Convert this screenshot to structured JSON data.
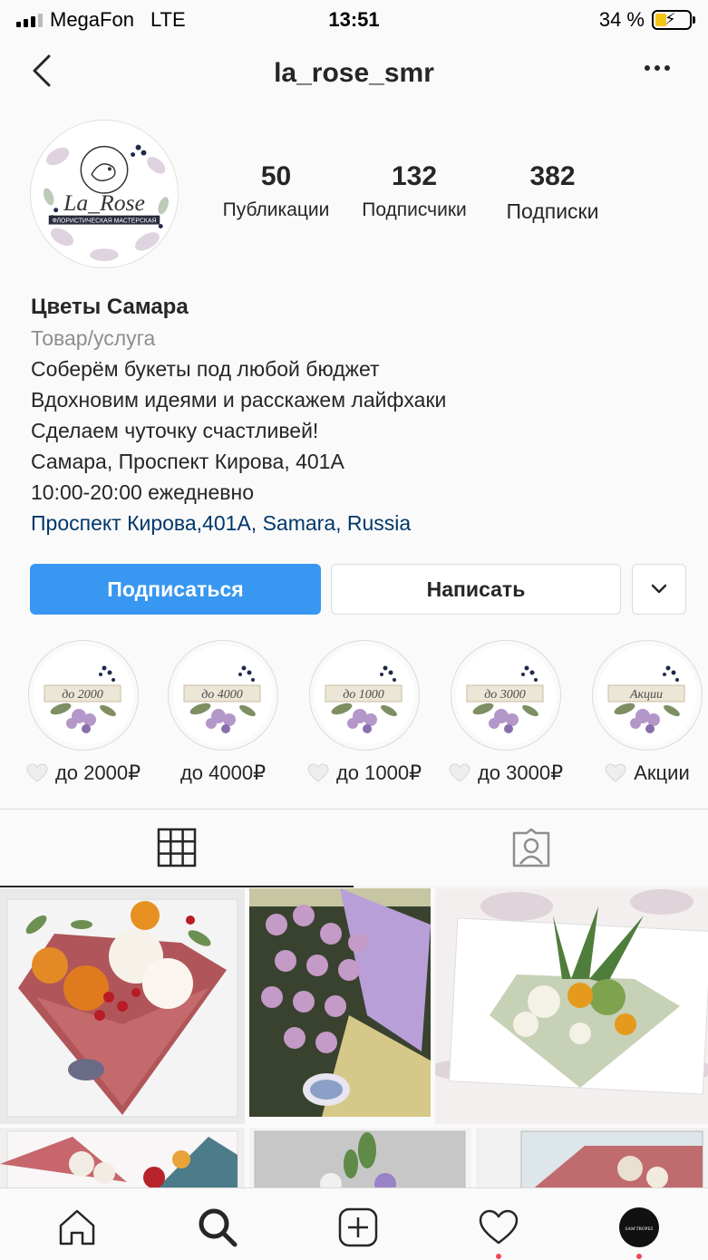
{
  "status_bar": {
    "carrier": "MegaFon",
    "network": "LTE",
    "time": "13:51",
    "battery": "34 %",
    "battery_level": 0.34
  },
  "header": {
    "title": "la_rose_smr"
  },
  "avatar": {
    "logo_text": "La_Rose",
    "logo_subtitle": "ФЛОРИСТИЧЕСКАЯ МАСТЕРСКАЯ"
  },
  "stats": [
    {
      "value": "50",
      "label": "Публикации"
    },
    {
      "value": "132",
      "label": "Подписчики"
    },
    {
      "value": "382",
      "label": "Подписки"
    }
  ],
  "bio": {
    "name": "Цветы Самара",
    "category": "Товар/услуга",
    "lines": [
      "Соберём букеты под любой бюджет",
      "Вдохновим идеями и расскажем лайфхаки",
      "Сделаем чуточку счастливей!",
      "Самара, Проспект Кирова, 401А",
      "10:00-20:00 ежедневно"
    ],
    "location": "Проспект Кирова,401A, Samara, Russia"
  },
  "buttons": {
    "follow": "Подписаться",
    "message": "Написать"
  },
  "highlights": [
    {
      "label": "до 2000₽",
      "cover_text": "до 2000",
      "heart": true
    },
    {
      "label": "до 4000₽",
      "cover_text": "до 4000",
      "heart": false
    },
    {
      "label": "до 1000₽",
      "cover_text": "до 1000",
      "heart": true
    },
    {
      "label": "до 3000₽",
      "cover_text": "до 3000",
      "heart": true
    },
    {
      "label": "Акции",
      "cover_text": "Акции",
      "heart": true
    }
  ],
  "bottom_nav": {
    "avatar_text": "SAM TROPEZ"
  },
  "colors": {
    "accent": "#3897f0",
    "link": "#00376b",
    "muted": "#8e8e8e",
    "notification": "#ed4956"
  }
}
